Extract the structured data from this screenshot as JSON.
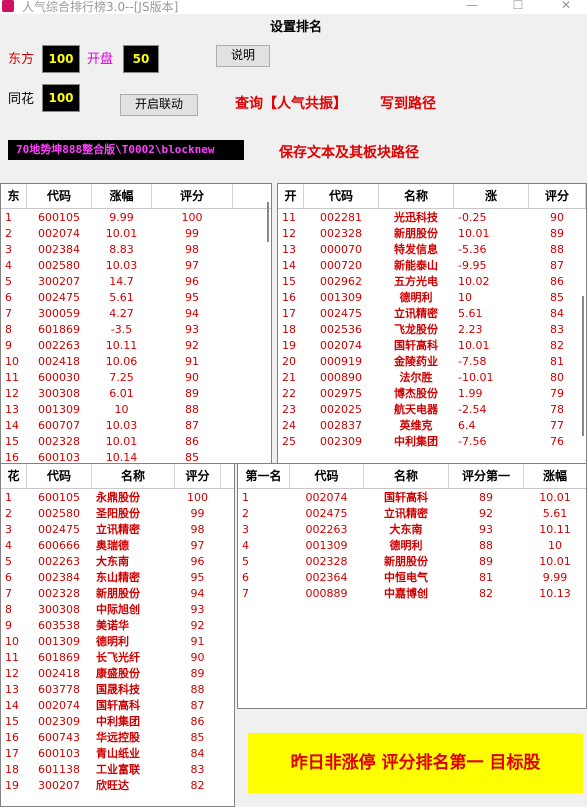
{
  "window": {
    "title": "人气综合排行榜3.0--[JS版本]",
    "minimize": "—",
    "maximize": "☐",
    "close": "✕"
  },
  "heading": "设置排名",
  "controls": {
    "dongfang_label": "东方",
    "dongfang_value": "100",
    "kaipan_label": "开盘",
    "kaipan_value": "50",
    "tonghua_label": "同花",
    "tonghua_value": "100",
    "explain_button": "说明",
    "link_button": "开启联动",
    "query_link": "查询【人气共振】",
    "write_path_link": "写到路径",
    "path_value": "70地势坤888整合版\\T0002\\blocknew",
    "save_path_link": "保存文本及其板块路径"
  },
  "colors": {
    "accent_red": "#e00000",
    "value_yellow": "#ffff00",
    "path_magenta": "#ff40ff",
    "kaipan_magenta": "#e000e0",
    "banner_bg": "#ffff00"
  },
  "east_table": {
    "headers": [
      "东",
      "代码",
      "涨幅",
      "评分"
    ],
    "rows": [
      [
        "1",
        "600105",
        "9.99",
        "100"
      ],
      [
        "2",
        "002074",
        "10.01",
        "99"
      ],
      [
        "3",
        "002384",
        "8.83",
        "98"
      ],
      [
        "4",
        "002580",
        "10.03",
        "97"
      ],
      [
        "5",
        "300207",
        "14.7",
        "96"
      ],
      [
        "6",
        "002475",
        "5.61",
        "95"
      ],
      [
        "7",
        "300059",
        "4.27",
        "94"
      ],
      [
        "8",
        "601869",
        "-3.5",
        "93"
      ],
      [
        "9",
        "002263",
        "10.11",
        "92"
      ],
      [
        "10",
        "002418",
        "10.06",
        "91"
      ],
      [
        "11",
        "600030",
        "7.25",
        "90"
      ],
      [
        "12",
        "300308",
        "6.01",
        "89"
      ],
      [
        "13",
        "001309",
        "10",
        "88"
      ],
      [
        "14",
        "600707",
        "10.03",
        "87"
      ],
      [
        "15",
        "002328",
        "10.01",
        "86"
      ],
      [
        "16",
        "600103",
        "10.14",
        "85"
      ]
    ]
  },
  "open_table": {
    "headers": [
      "开",
      "代码",
      "名称",
      "涨",
      "评分"
    ],
    "rows": [
      [
        "11",
        "002281",
        "光迅科技",
        "-0.25",
        "90"
      ],
      [
        "12",
        "002328",
        "新朋股份",
        "10.01",
        "89"
      ],
      [
        "13",
        "000070",
        "特发信息",
        "-5.36",
        "88"
      ],
      [
        "14",
        "000720",
        "新能泰山",
        "-9.95",
        "87"
      ],
      [
        "15",
        "002962",
        "五方光电",
        "10.02",
        "86"
      ],
      [
        "16",
        "001309",
        "德明利",
        "10",
        "85"
      ],
      [
        "17",
        "002475",
        "立讯精密",
        "5.61",
        "84"
      ],
      [
        "18",
        "002536",
        "飞龙股份",
        "2.23",
        "83"
      ],
      [
        "19",
        "002074",
        "国轩高科",
        "10.01",
        "82"
      ],
      [
        "20",
        "000919",
        "金陵药业",
        "-7.58",
        "81"
      ],
      [
        "21",
        "000890",
        "法尔胜",
        "-10.01",
        "80"
      ],
      [
        "22",
        "002975",
        "博杰股份",
        "1.99",
        "79"
      ],
      [
        "23",
        "002025",
        "航天电器",
        "-2.54",
        "78"
      ],
      [
        "24",
        "002837",
        "英维克",
        "6.4",
        "77"
      ],
      [
        "25",
        "002309",
        "中利集团",
        "-7.56",
        "76"
      ]
    ]
  },
  "flower_table": {
    "headers": [
      "花",
      "代码",
      "名称",
      "评分"
    ],
    "rows": [
      [
        "1",
        "600105",
        "永鼎股份",
        "100"
      ],
      [
        "2",
        "002580",
        "圣阳股份",
        "99"
      ],
      [
        "3",
        "002475",
        "立讯精密",
        "98"
      ],
      [
        "4",
        "600666",
        "奥瑞德",
        "97"
      ],
      [
        "5",
        "002263",
        "大东南",
        "96"
      ],
      [
        "6",
        "002384",
        "东山精密",
        "95"
      ],
      [
        "7",
        "002328",
        "新朋股份",
        "94"
      ],
      [
        "8",
        "300308",
        "中际旭创",
        "93"
      ],
      [
        "9",
        "603538",
        "美诺华",
        "92"
      ],
      [
        "10",
        "001309",
        "德明利",
        "91"
      ],
      [
        "11",
        "601869",
        "长飞光纤",
        "90"
      ],
      [
        "12",
        "002418",
        "康盛股份",
        "89"
      ],
      [
        "13",
        "603778",
        "国晟科技",
        "88"
      ],
      [
        "14",
        "002074",
        "国轩高科",
        "87"
      ],
      [
        "15",
        "002309",
        "中利集团",
        "86"
      ],
      [
        "16",
        "600743",
        "华远控股",
        "85"
      ],
      [
        "17",
        "600103",
        "青山纸业",
        "84"
      ],
      [
        "18",
        "601138",
        "工业富联",
        "83"
      ],
      [
        "19",
        "300207",
        "欣旺达",
        "82"
      ]
    ]
  },
  "first_table": {
    "headers": [
      "第一名",
      "代码",
      "名称",
      "评分第一",
      "涨幅"
    ],
    "rows": [
      [
        "1",
        "002074",
        "国轩高科",
        "89",
        "10.01"
      ],
      [
        "2",
        "002475",
        "立讯精密",
        "92",
        "5.61"
      ],
      [
        "3",
        "002263",
        "大东南",
        "93",
        "10.11"
      ],
      [
        "4",
        "001309",
        "德明利",
        "88",
        "10"
      ],
      [
        "5",
        "002328",
        "新朋股份",
        "89",
        "10.01"
      ],
      [
        "6",
        "002364",
        "中恒电气",
        "81",
        "9.99"
      ],
      [
        "7",
        "000889",
        "中嘉博创",
        "82",
        "10.13"
      ]
    ]
  },
  "banner": "昨日非涨停  评分排名第一  目标股"
}
